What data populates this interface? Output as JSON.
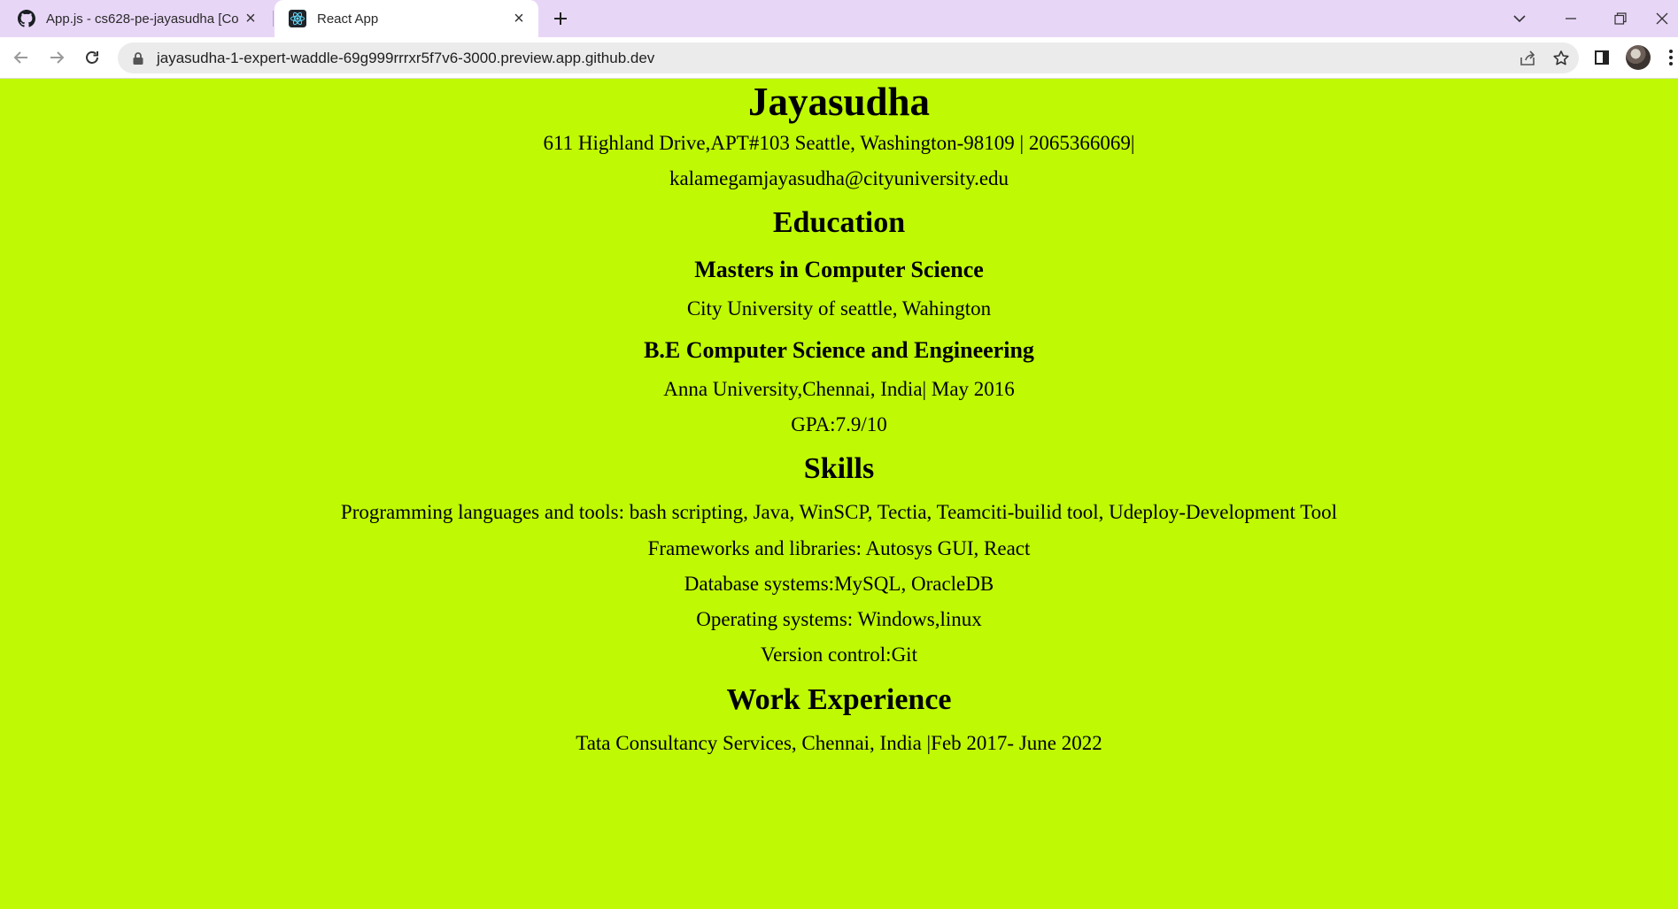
{
  "browser": {
    "tabs": [
      {
        "title": "App.js - cs628-pe-jayasudha [Co",
        "favicon": "github-icon",
        "active": false
      },
      {
        "title": "React App",
        "favicon": "react-icon",
        "active": true
      }
    ],
    "url": "jayasudha-1-expert-waddle-69g999rrrxr5f7v6-3000.preview.app.github.dev",
    "colors": {
      "tabbar": "#e8d6f7",
      "page_background": "#bff904"
    }
  },
  "resume": {
    "name": "Jayasudha",
    "address": "611 Highland Drive,APT#103 Seattle, Washington-98109 | 2065366069|",
    "email": "kalamegamjayasudha@cityuniversity.edu",
    "education": {
      "heading": "Education",
      "items": [
        {
          "degree": "Masters in Computer Science",
          "details": [
            "City University of seattle, Wahington"
          ]
        },
        {
          "degree": "B.E Computer Science and Engineering",
          "details": [
            "Anna University,Chennai, India| May 2016",
            "GPA:7.9/10"
          ]
        }
      ]
    },
    "skills": {
      "heading": "Skills",
      "items": [
        "Programming languages and tools: bash scripting, Java, WinSCP, Tectia, Teamciti-builid tool, Udeploy-Development Tool",
        "Frameworks and libraries: Autosys GUI, React",
        "Database systems:MySQL, OracleDB",
        "Operating systems: Windows,linux",
        "Version control:Git"
      ]
    },
    "work": {
      "heading": "Work Experience",
      "items": [
        "Tata Consultancy Services, Chennai, India |Feb 2017- June 2022"
      ]
    }
  }
}
